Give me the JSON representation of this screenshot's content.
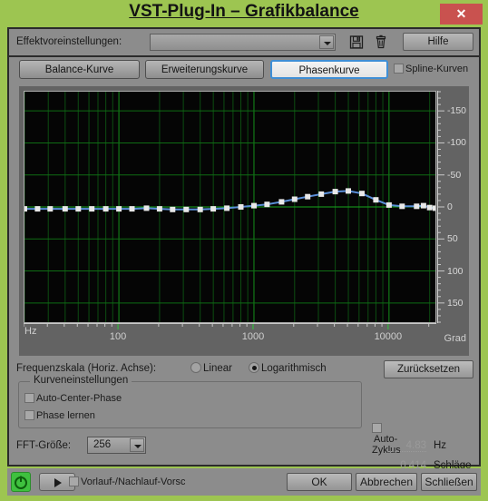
{
  "window": {
    "title": "VST-Plug-In – Grafikbalance",
    "close_label": "✕",
    "titlebar_color": "#9dc551",
    "close_color": "#c9524f"
  },
  "preset_bar": {
    "label": "Effektvoreinstellungen:",
    "combo_value": "",
    "save_icon": "floppy-disk-icon",
    "delete_icon": "trash-icon",
    "help_label": "Hilfe"
  },
  "tabs": [
    {
      "label": "Balance-Kurve",
      "active": false
    },
    {
      "label": "Erweiterungskurve",
      "active": false
    },
    {
      "label": "Phasenkurve",
      "active": true
    }
  ],
  "spline": {
    "label": "Spline-Kurven",
    "checked": false
  },
  "chart_data": {
    "type": "line",
    "title": "Phasenkurve",
    "xlabel": "Hz",
    "ylabel": "Grad",
    "xscale": "log",
    "xlim": [
      20,
      22050
    ],
    "ylim": [
      -180,
      180
    ],
    "y_inverted": true,
    "grid": true,
    "legend": "none",
    "ytick_labels": [
      "-150",
      "-100",
      "-50",
      "0",
      "50",
      "100",
      "150"
    ],
    "ytick_values": [
      -150,
      -100,
      -50,
      0,
      50,
      100,
      150
    ],
    "xtick_labels": [
      "100",
      "1000",
      "10000"
    ],
    "xtick_values": [
      100,
      1000,
      10000
    ],
    "line_color": "#5a8fd8",
    "point_color": "#e8e8e8",
    "grid_color": "#0d5c12",
    "bg_color": "#050505",
    "series": [
      {
        "name": "Phase",
        "x": [
          20,
          25,
          31,
          40,
          50,
          63,
          80,
          100,
          125,
          160,
          200,
          250,
          315,
          400,
          500,
          630,
          800,
          1000,
          1250,
          1600,
          2000,
          2500,
          3150,
          4000,
          5000,
          6300,
          8000,
          10000,
          12500,
          16000,
          18000,
          20000,
          22050
        ],
        "y": [
          3,
          3,
          3,
          3,
          3,
          3,
          3,
          3,
          3,
          2,
          3,
          4,
          4,
          4,
          3,
          2,
          0,
          -2,
          -4,
          -8,
          -12,
          -16,
          -20,
          -24,
          -25,
          -21,
          -11,
          -3,
          -1,
          -1,
          -2,
          1,
          2
        ]
      }
    ]
  },
  "freq_scale": {
    "label": "Frequenzskala (Horiz. Achse):",
    "options": [
      {
        "label": "Linear",
        "selected": false
      },
      {
        "label": "Logarithmisch",
        "selected": true
      }
    ],
    "reset_label": "Zurücksetzen"
  },
  "curve_settings": {
    "group_title": "Kurveneinstellungen",
    "checkboxes": [
      {
        "label": "Auto-Center-Phase",
        "checked": false
      },
      {
        "label": "Phase lernen",
        "checked": false
      }
    ]
  },
  "auto_cycle": {
    "label": "Auto-Zyklus",
    "checked": false,
    "hz_value": "4.83",
    "hz_unit": "Hz",
    "beats_value": "0.414",
    "beats_unit": "Schläge"
  },
  "fft": {
    "label": "FFT-Größe:",
    "value": "256"
  },
  "footer": {
    "power_icon": "power-icon",
    "play_icon": "play-icon",
    "prefetch_label": "Vorlauf-/Nachlauf-Vorsch",
    "prefetch_checked": false,
    "ok_label": "OK",
    "cancel_label": "Abbrechen",
    "close_label": "Schließen"
  }
}
